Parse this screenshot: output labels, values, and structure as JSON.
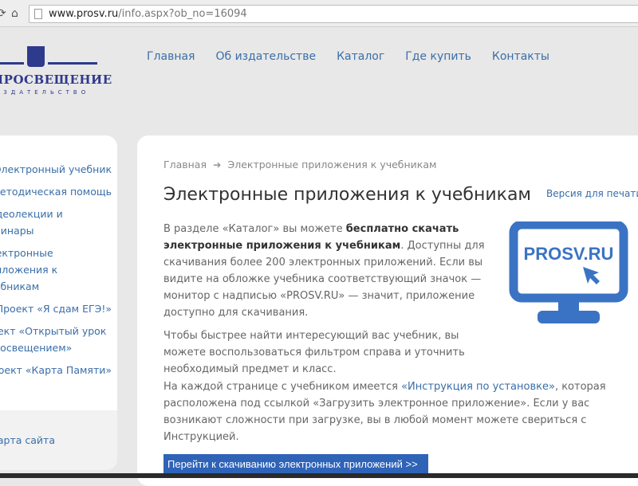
{
  "browser": {
    "url_host": "www.prosv.ru",
    "url_path": "/info.aspx?ob_no=16094"
  },
  "logo": {
    "name": "ПРОСВЕЩЕНИЕ",
    "sub": "ИЗДАТЕЛЬСТВО"
  },
  "nav": [
    "Главная",
    "Об издательстве",
    "Каталог",
    "Где купить",
    "Контакты"
  ],
  "sidebar": {
    "items": [
      "Электронный учебник",
      "Методическая помощь",
      "Видеолекции и вебинары",
      "Электронные приложения к учебникам",
      "Проект «Я сдам ЕГЭ!»",
      "Проект «Открытый урок с Просвещением»",
      "Проект «Карта Памяти»"
    ],
    "footer": "Карта сайта"
  },
  "breadcrumb": {
    "home": "Главная",
    "current": "Электронные приложения к учебникам"
  },
  "title": "Электронные приложения к учебникам",
  "print_link": "Версия для печати",
  "p1": {
    "a": "В разделе «Каталог» вы можете ",
    "bold": "бесплатно скачать электронные приложения к учебникам",
    "b": ". Доступны для скачивания более 200 электронных приложений. Если вы видите на обложке учебника соответствующий значок — монитор с надписью «PROSV.RU» — значит, приложение доступно для скачивания."
  },
  "p2": "Чтобы быстрее найти интересующий вас учебник, вы можете воспользоваться фильтром справа и уточнить необходимый предмет и класс.",
  "p3": {
    "a": "На каждой странице с учебником имеется ",
    "link": "«Инструкция по установке»",
    "b": ", которая расположена под ссылкой «Загрузить электронное приложение». Если у вас возникают сложности при загрузке, вы в любой момент можете свериться с Инструкцией."
  },
  "monitor_text": "PROSV.RU",
  "button": "Перейти к скачиванию электронных приложений >>",
  "colors": {
    "brand": "#2e3a8c",
    "link": "#3a6ea8",
    "button": "#2e63b8",
    "monitor": "#3b73c4"
  }
}
